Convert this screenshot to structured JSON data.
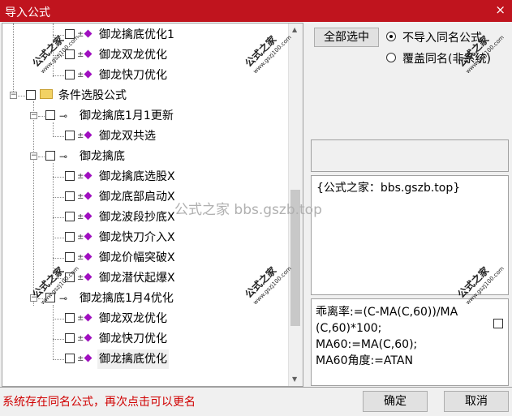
{
  "window": {
    "title": "导入公式",
    "close_glyph": "×"
  },
  "tree": {
    "items": [
      {
        "label": "御龙擒底优化1",
        "type": "formula"
      },
      {
        "label": "御龙双龙优化",
        "type": "formula"
      },
      {
        "label": "御龙快刀优化",
        "type": "formula"
      },
      {
        "label": "条件选股公式",
        "type": "folder"
      },
      {
        "label": "御龙擒底1月1更新",
        "type": "key"
      },
      {
        "label": "御龙双共选",
        "type": "formula"
      },
      {
        "label": "御龙擒底",
        "type": "key"
      },
      {
        "label": "御龙擒底选股X",
        "type": "formula"
      },
      {
        "label": "御龙底部启动X",
        "type": "formula"
      },
      {
        "label": "御龙波段抄底X",
        "type": "formula"
      },
      {
        "label": "御龙快刀介入X",
        "type": "formula"
      },
      {
        "label": "御龙价幅突破X",
        "type": "formula"
      },
      {
        "label": "御龙潜伏起爆X",
        "type": "formula"
      },
      {
        "label": "御龙擒底1月4优化",
        "type": "key"
      },
      {
        "label": "御龙双龙优化",
        "type": "formula"
      },
      {
        "label": "御龙快刀优化",
        "type": "formula"
      },
      {
        "label": "御龙擒底优化",
        "type": "formula"
      }
    ]
  },
  "options": {
    "select_all_label": "全部选中",
    "radio_no_import": "不导入同名公式",
    "radio_overwrite": "覆盖同名(非系统)"
  },
  "info": {
    "text": "{公式之家：bbs.gszb.top}"
  },
  "formula": {
    "lines": [
      "乖离率:=(C-MA(C,60))/MA",
      "(C,60)*100;",
      "MA60:=MA(C,60);",
      "MA60角度:=ATAN"
    ]
  },
  "watermark": {
    "main": "公式之家",
    "url": "www.gszj100.com",
    "center": "公式之家 bbs.gszb.top"
  },
  "status": {
    "message": "系统存在同名公式，再次点击可以更名"
  },
  "buttons": {
    "ok": "确定",
    "cancel": "取消"
  },
  "colors": {
    "titlebar": "#c0141e",
    "status_text": "#d00000",
    "formula_icon": "#a010c0"
  }
}
